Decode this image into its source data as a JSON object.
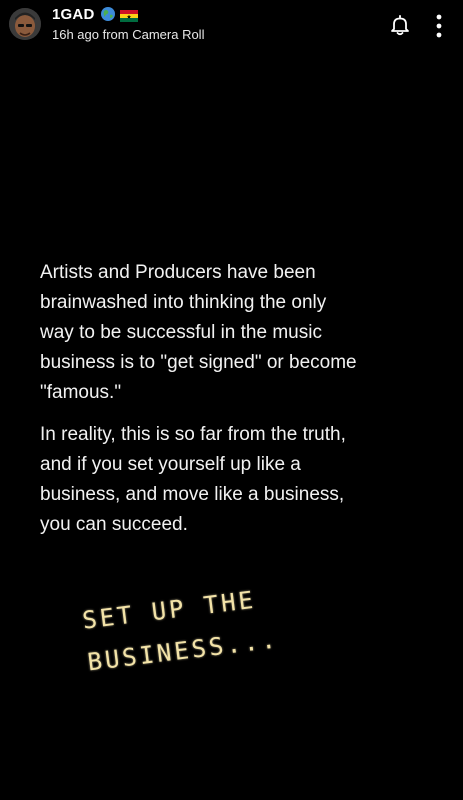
{
  "header": {
    "username": "1GAD",
    "badges": [
      {
        "icon": "globe-emoji-icon"
      },
      {
        "icon": "ghana-flag-icon"
      }
    ],
    "subtitle": "16h ago from Camera Roll",
    "actions": [
      {
        "icon": "bell-icon"
      },
      {
        "icon": "more-vertical-icon"
      }
    ]
  },
  "caption": {
    "paragraph1": "Artists and Producers have been\nbrainwashed into thinking the only\nway to be successful in the music\nbusiness is to \"get signed\" or become\n\"famous.\"",
    "paragraph2": "In reality, this is so far from the truth,\nand if you set yourself up like a\nbusiness, and move like a business,\nyou can succeed."
  },
  "sticker": {
    "text": "SET UP THE\nBUSINESS...",
    "color": "#f3e3a8"
  },
  "colors": {
    "background": "#000000",
    "text": "#f2f2f2"
  }
}
